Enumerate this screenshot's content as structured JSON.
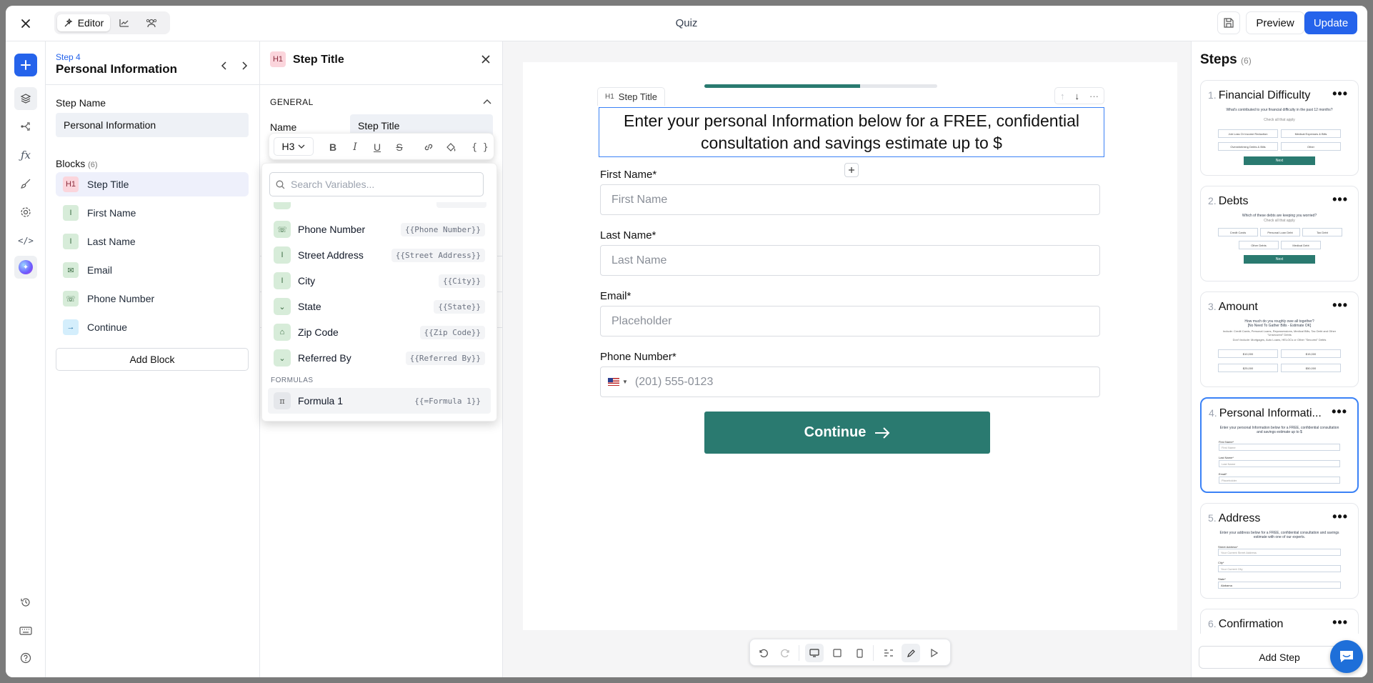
{
  "topbar": {
    "editor_label": "Editor",
    "title": "Quiz",
    "preview_label": "Preview",
    "update_label": "Update"
  },
  "panel1": {
    "step_number": "Step 4",
    "step_title": "Personal Information",
    "step_name_label": "Step Name",
    "step_name_value": "Personal Information",
    "blocks_label": "Blocks",
    "blocks_count": "(6)",
    "blocks": [
      {
        "label": "Step Title",
        "badge": "H1"
      },
      {
        "label": "First Name",
        "badge": "I"
      },
      {
        "label": "Last Name",
        "badge": "I"
      },
      {
        "label": "Email",
        "badge": "✉"
      },
      {
        "label": "Phone Number",
        "badge": "☏"
      },
      {
        "label": "Continue",
        "badge": "→"
      }
    ],
    "add_block_label": "Add Block"
  },
  "panel2": {
    "badge": "H1",
    "title": "Step Title",
    "section_label": "GENERAL",
    "name_label": "Name",
    "name_value": "Step Title",
    "heading_level": "H3",
    "search_placeholder": "Search Variables...",
    "variables": [
      {
        "label": "Phone Number",
        "token": "{{Phone Number}}"
      },
      {
        "label": "Street Address",
        "token": "{{Street Address}}"
      },
      {
        "label": "City",
        "token": "{{City}}"
      },
      {
        "label": "State",
        "token": "{{State}}"
      },
      {
        "label": "Zip Code",
        "token": "{{Zip Code}}"
      },
      {
        "label": "Referred By",
        "token": "{{Referred By}}"
      }
    ],
    "formulas_label": "FORMULAS",
    "formula": {
      "label": "Formula 1",
      "token": "{{=Formula 1}}"
    }
  },
  "canvas": {
    "progress": 0.67,
    "tag_badge": "H1",
    "tag_label": "Step Title",
    "heading_line1": "Enter your personal Information below for a FREE, confidential",
    "heading_line2": "consultation and savings estimate up to $",
    "fields": [
      {
        "label": "First Name*",
        "placeholder": "First Name"
      },
      {
        "label": "Last Name*",
        "placeholder": "Last Name"
      },
      {
        "label": "Email*",
        "placeholder": "Placeholder"
      }
    ],
    "phone_label": "Phone Number*",
    "phone_placeholder": "(201) 555-0123",
    "continue_label": "Continue"
  },
  "steps": {
    "title": "Steps",
    "count": "(6)",
    "items": [
      {
        "num": "1.",
        "title": "Financial Difficulty"
      },
      {
        "num": "2.",
        "title": "Debts"
      },
      {
        "num": "3.",
        "title": "Amount"
      },
      {
        "num": "4.",
        "title": "Personal Informati..."
      },
      {
        "num": "5.",
        "title": "Address"
      },
      {
        "num": "6.",
        "title": "Confirmation"
      }
    ],
    "add_step_label": "Add Step",
    "thumbs": {
      "s1_q": "What's contributed to your financial difficulty in the past 12 months?",
      "s1_sub": "Check all that apply",
      "s1_opts": [
        "Job Loss Or Income Reduction",
        "Medical Expenses & Bills",
        "Overwhelming Debts & Bills",
        "Other"
      ],
      "next": "Next",
      "s2_q": "Which of these debts are keeping you worried?",
      "s2_sub": "Check all that apply",
      "s2_opts": [
        "Credit Cards",
        "Personal Loan Debt",
        "Tax Debt",
        "Other Debts",
        "Medical Debt"
      ],
      "s3_q": "How much do you roughly owe all together?",
      "s3_q2": "[No Need To Gather Bills - Estimate OK]",
      "s3_inc": "Include: Credit Cards, Personal Loans, Repossessions, Medical Bills, Tax Debt and Other \"Unsecured\" Debts",
      "s3_exc": "Don't Include: Mortgages, Auto Loans, HELOCs or Other \"Secured\" Debts",
      "s3_opts": [
        "$10,000",
        "$15,000",
        "$25,000",
        "$50,000"
      ],
      "s4_q": "Enter your personal Information below for a FREE, confidential consultation and savings estimate up to $",
      "s4_labels": [
        "First Name*",
        "Last Name*",
        "Email*"
      ],
      "s4_ph": [
        "First Name",
        "Last Name",
        "Placeholder"
      ],
      "s5_q": "Enter your address below for a FREE, confidential consultation and savings estimate with one of our experts.",
      "s5_labels": [
        "Street Address*",
        "City*",
        "State*"
      ],
      "s5_ph": [
        "Your Current Street Address",
        "Your Current City",
        "Alabama"
      ]
    }
  }
}
